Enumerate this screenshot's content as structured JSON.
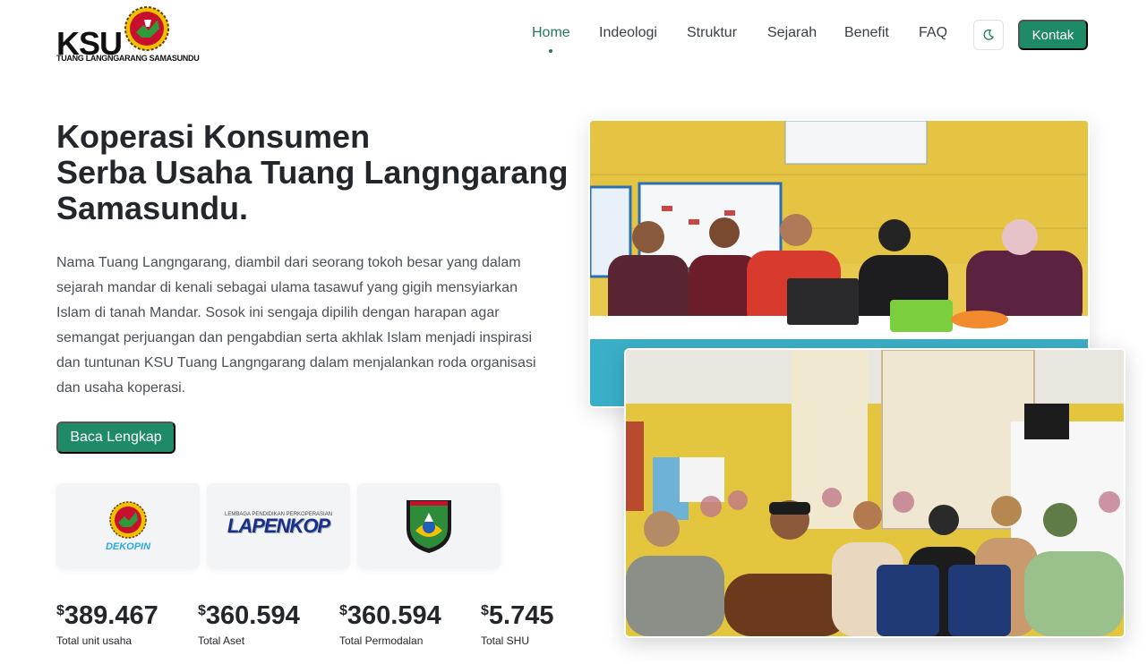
{
  "brand": {
    "name": "KSU",
    "subtitle": "TUANG LANGNGARANG SAMASUNDU"
  },
  "nav": {
    "items": [
      {
        "label": "Home",
        "active": true
      },
      {
        "label": "Indeologi",
        "active": false
      },
      {
        "label": "Struktur",
        "active": false
      },
      {
        "label": "Sejarah",
        "active": false
      },
      {
        "label": "Benefit",
        "active": false
      },
      {
        "label": "FAQ",
        "active": false
      }
    ],
    "theme_icon": "moon-icon",
    "contact_label": "Kontak"
  },
  "hero": {
    "title_lines": [
      "Koperasi Konsumen",
      "Serba Usaha Tuang Langngarang",
      "Samasundu."
    ],
    "description": "Nama Tuang Langngarang, diambil dari seorang tokoh besar yang dalam sejarah mandar di kenali sebagai ulama tasawuf yang gigih mensyiarkan Islam di tanah Mandar. Sosok ini sengaja dipilih dengan harapan agar semangat perjuangan dan pengabdian serta akhlak Islam menjadi inspirasi dan tuntunan KSU Tuang Langngarang dalam menjalankan roda organisasi dan usaha koperasi.",
    "read_more_label": "Baca Lengkap"
  },
  "partners": {
    "dekopin": "DEKOPIN",
    "lapenkop_caption": "LEMBAGA PENDIDIKAN PERKOPERASIAN",
    "lapenkop": "LAPENKOP",
    "regency_emblem": "polewali-mandar-emblem"
  },
  "stats": [
    {
      "currency": "$",
      "value": "389.467",
      "label": "Total unit usaha"
    },
    {
      "currency": "$",
      "value": "360.594",
      "label": "Total Aset"
    },
    {
      "currency": "$",
      "value": "360.594",
      "label": "Total Permodalan"
    },
    {
      "currency": "$",
      "value": "5.745",
      "label": "Total SHU"
    }
  ],
  "colors": {
    "accent": "#1f8a68",
    "accent_text": "#1f7a5c",
    "heading": "#23272b",
    "body": "#4a5056"
  }
}
